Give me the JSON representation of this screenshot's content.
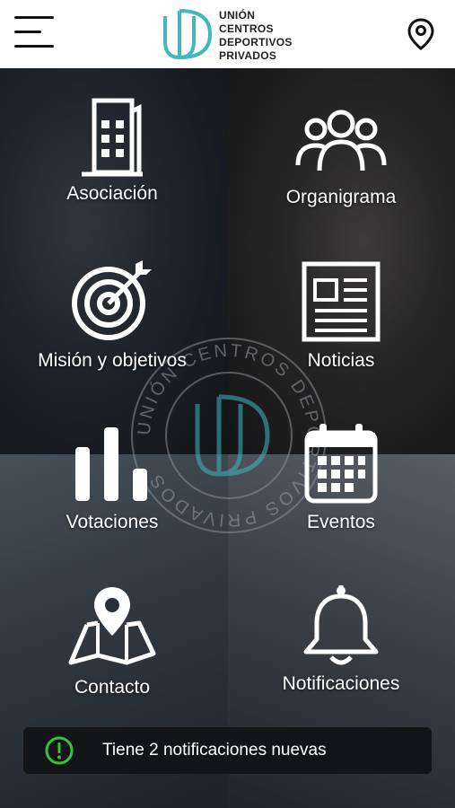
{
  "header": {
    "logo_lines": [
      "UNIÓN",
      "CENTROS",
      "DEPORTIVOS",
      "PRIVADOS"
    ],
    "menu_icon": "hamburger-menu-icon",
    "location_icon": "location-pin-icon"
  },
  "watermark": {
    "ring_text": "UNIÓN CENTROS DEPORTIVOS PRIVADOS"
  },
  "tiles": [
    {
      "label": "Asociación",
      "icon": "building-icon"
    },
    {
      "label": "Organigrama",
      "icon": "group-icon"
    },
    {
      "label": "Misión y objetivos",
      "icon": "target-icon"
    },
    {
      "label": "Noticias",
      "icon": "newspaper-icon"
    },
    {
      "label": "Votaciones",
      "icon": "bar-chart-icon"
    },
    {
      "label": "Eventos",
      "icon": "calendar-icon"
    },
    {
      "label": "Contacto",
      "icon": "map-pin-icon"
    },
    {
      "label": "Notificaciones",
      "icon": "bell-icon"
    }
  ],
  "toast": {
    "message": "Tiene 2 notificaciones nuevas",
    "icon": "alert-circle-icon"
  },
  "colors": {
    "brand": "#3fb8c0",
    "alert": "#37c23a",
    "header_bg": "#ffffff",
    "toast_bg": "#121518"
  }
}
